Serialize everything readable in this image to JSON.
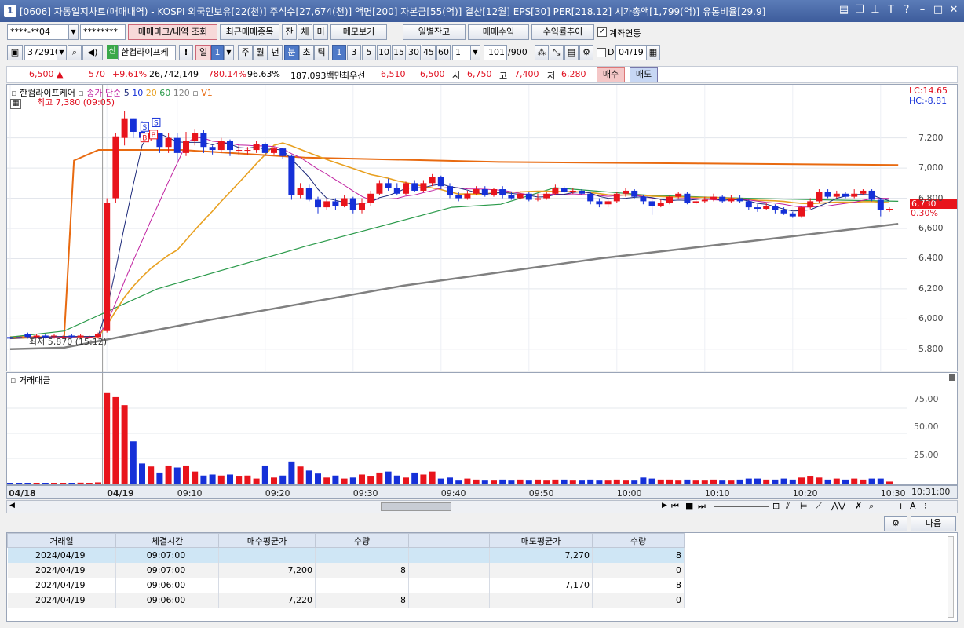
{
  "window": {
    "title": "[0606] 자동일지차트(매매내역) - KOSPI 외국인보유[22(천)] 주식수[27,674(천)] 액면[200] 자본금[55(억)] 결산[12월] EPS[30] PER[218.12] 시가총액[1,799(억)] 유통비율[29.9]",
    "icon": "1"
  },
  "toolbar1": {
    "account": "****-**04",
    "password": "********",
    "btn_mark": "매매마크/내역 조회",
    "btn_recent": "최근매매종목",
    "btn_jan": "잔",
    "btn_che": "체",
    "btn_mi": "미",
    "btn_memo": "메모보기",
    "btn_daily": "일별잔고",
    "btn_profit": "매매수익",
    "btn_trend": "수익률추이",
    "link_label": "계좌연동",
    "link_checked": true
  },
  "toolbar2": {
    "code": "372910",
    "badge": "신",
    "name": "한컴라이프케",
    "btn_excl": "!",
    "period_day": "일",
    "period_num": "1",
    "btn_week": "주",
    "btn_month": "월",
    "btn_year": "년",
    "btn_min": "분",
    "btn_sec": "초",
    "btn_tick": "틱",
    "intervals": [
      "1",
      "3",
      "5",
      "10",
      "15",
      "30",
      "45",
      "60"
    ],
    "count": "1",
    "bars": "101",
    "bars_total": "/900",
    "date_check_label": "D",
    "date": "04/19"
  },
  "quote": {
    "price": "6,500 ▲",
    "change": "570",
    "pct": "+9.61%",
    "volume": "26,742,149",
    "vol_pct": "780.14%",
    "strength": "96.63%",
    "amount": "187,093백만",
    "best_label": "최우선",
    "ask": "6,510",
    "bid": "6,500",
    "open_label": "시",
    "open": "6,750",
    "high_label": "고",
    "high": "7,400",
    "low_label": "저",
    "low": "6,280",
    "buy_btn": "매수",
    "sell_btn": "매도"
  },
  "price_chart": {
    "stock_label": "한컴라이프케어",
    "ma_label": "종가 단순",
    "ma_periods": [
      "5",
      "10",
      "20",
      "60",
      "120"
    ],
    "vi_label": "V1",
    "high_marker": "최고 7,380 (09:05)",
    "low_marker": "최저 5,870 (15:12)",
    "lc": "LC:14.65",
    "hc": "HC:-8.81",
    "current_price": "6,730",
    "current_pct": "0.30%",
    "colors": {
      "up": "#e8141c",
      "down": "#1530d8",
      "ma5": "#1d2a7a",
      "ma10": "#c020a0",
      "ma20": "#e8a020",
      "ma60": "#2a9a4a",
      "ma120": "#808080",
      "vi": "#e86a10"
    }
  },
  "volume_chart": {
    "title": "거래대금",
    "ticks": [
      "75,00",
      "50,00",
      "25,00"
    ]
  },
  "chart_data": {
    "type": "candlestick",
    "ylim": [
      5700,
      7500
    ],
    "y_ticks": [
      "7,200",
      "7,000",
      "6,800",
      "6,600",
      "6,400",
      "6,200",
      "6,000",
      "5,800"
    ],
    "x_labels": [
      "04/18",
      "04/19",
      "09:10",
      "09:20",
      "09:30",
      "09:40",
      "09:50",
      "10:00",
      "10:10",
      "10:20",
      "10:30"
    ],
    "candles": [
      [
        5880,
        5870,
        5880,
        5870,
        0.4
      ],
      [
        5880,
        5875,
        5880,
        5870,
        0.4
      ],
      [
        5900,
        5880,
        5910,
        5870,
        0.5
      ],
      [
        5880,
        5890,
        5900,
        5870,
        0.4
      ],
      [
        5890,
        5880,
        5900,
        5870,
        0.5
      ],
      [
        5885,
        5890,
        5900,
        5870,
        0.6
      ],
      [
        5880,
        5880,
        5890,
        5870,
        0.4
      ],
      [
        5890,
        5880,
        5900,
        5870,
        0.5
      ],
      [
        5880,
        5890,
        5900,
        5870,
        0.9
      ],
      [
        5880,
        5880,
        5890,
        5870,
        0.5
      ],
      [
        5880,
        5900,
        5910,
        5870,
        1.2
      ],
      [
        5920,
        6770,
        6800,
        5910,
        90
      ],
      [
        6800,
        7210,
        7230,
        6770,
        86
      ],
      [
        7200,
        7330,
        7380,
        7150,
        78
      ],
      [
        7330,
        7240,
        7330,
        7200,
        42
      ],
      [
        7240,
        7200,
        7310,
        7180,
        20
      ],
      [
        7200,
        7230,
        7240,
        7180,
        17
      ],
      [
        7230,
        7140,
        7230,
        7100,
        11
      ],
      [
        7140,
        7200,
        7230,
        7100,
        18
      ],
      [
        7200,
        7100,
        7230,
        7050,
        16
      ],
      [
        7100,
        7180,
        7240,
        7080,
        18
      ],
      [
        7180,
        7230,
        7260,
        7150,
        12
      ],
      [
        7230,
        7140,
        7250,
        7100,
        8
      ],
      [
        7140,
        7120,
        7150,
        7090,
        9
      ],
      [
        7120,
        7180,
        7200,
        7100,
        8
      ],
      [
        7180,
        7120,
        7190,
        7080,
        9
      ],
      [
        7120,
        7120,
        7150,
        7090,
        7
      ],
      [
        7120,
        7120,
        7140,
        7090,
        8
      ],
      [
        7120,
        7160,
        7180,
        7100,
        5
      ],
      [
        7160,
        7100,
        7170,
        7080,
        18
      ],
      [
        7100,
        7130,
        7140,
        7090,
        6
      ],
      [
        7130,
        7080,
        7130,
        7060,
        8
      ],
      [
        7080,
        6820,
        7090,
        6790,
        22
      ],
      [
        6820,
        6870,
        6900,
        6800,
        17
      ],
      [
        6870,
        6790,
        6890,
        6780,
        13
      ],
      [
        6790,
        6740,
        6810,
        6700,
        10
      ],
      [
        6740,
        6780,
        6800,
        6720,
        6
      ],
      [
        6780,
        6750,
        6800,
        6720,
        8
      ],
      [
        6750,
        6800,
        6820,
        6740,
        5
      ],
      [
        6800,
        6720,
        6810,
        6700,
        6
      ],
      [
        6720,
        6770,
        6800,
        6700,
        9
      ],
      [
        6770,
        6830,
        6850,
        6750,
        7
      ],
      [
        6830,
        6900,
        6920,
        6820,
        11
      ],
      [
        6900,
        6870,
        6930,
        6850,
        12
      ],
      [
        6870,
        6830,
        6900,
        6820,
        8
      ],
      [
        6830,
        6900,
        6910,
        6820,
        6
      ],
      [
        6900,
        6850,
        6920,
        6840,
        11
      ],
      [
        6850,
        6900,
        6920,
        6840,
        9
      ],
      [
        6900,
        6940,
        6960,
        6880,
        12
      ],
      [
        6940,
        6880,
        6950,
        6860,
        5
      ],
      [
        6880,
        6820,
        6900,
        6800,
        6
      ],
      [
        6820,
        6800,
        6840,
        6780,
        3
      ],
      [
        6800,
        6830,
        6850,
        6790,
        5
      ],
      [
        6830,
        6860,
        6880,
        6820,
        4
      ],
      [
        6860,
        6820,
        6880,
        6810,
        3
      ],
      [
        6820,
        6860,
        6870,
        6810,
        3
      ],
      [
        6860,
        6820,
        6880,
        6800,
        4
      ],
      [
        6820,
        6800,
        6840,
        6790,
        3
      ],
      [
        6800,
        6830,
        6850,
        6790,
        4
      ],
      [
        6830,
        6790,
        6840,
        6780,
        3
      ],
      [
        6790,
        6800,
        6830,
        6780,
        4
      ],
      [
        6800,
        6830,
        6840,
        6790,
        3
      ],
      [
        6830,
        6870,
        6890,
        6820,
        4
      ],
      [
        6870,
        6840,
        6880,
        6830,
        4
      ],
      [
        6840,
        6850,
        6870,
        6830,
        3
      ],
      [
        6850,
        6830,
        6860,
        6820,
        3
      ],
      [
        6830,
        6780,
        6840,
        6760,
        4
      ],
      [
        6780,
        6760,
        6800,
        6740,
        3
      ],
      [
        6760,
        6780,
        6800,
        6740,
        3
      ],
      [
        6780,
        6830,
        6840,
        6770,
        4
      ],
      [
        6830,
        6850,
        6870,
        6810,
        3
      ],
      [
        6850,
        6810,
        6860,
        6800,
        3
      ],
      [
        6810,
        6780,
        6820,
        6760,
        6
      ],
      [
        6780,
        6750,
        6790,
        6690,
        5
      ],
      [
        6750,
        6770,
        6790,
        6740,
        4
      ],
      [
        6770,
        6810,
        6820,
        6760,
        4
      ],
      [
        6810,
        6830,
        6840,
        6800,
        3
      ],
      [
        6830,
        6770,
        6840,
        6760,
        4
      ],
      [
        6770,
        6780,
        6800,
        6760,
        3
      ],
      [
        6780,
        6790,
        6810,
        6770,
        3
      ],
      [
        6790,
        6810,
        6830,
        6780,
        4
      ],
      [
        6810,
        6780,
        6820,
        6770,
        3
      ],
      [
        6780,
        6800,
        6820,
        6770,
        3
      ],
      [
        6800,
        6780,
        6820,
        6770,
        4
      ],
      [
        6780,
        6740,
        6790,
        6720,
        5
      ],
      [
        6740,
        6730,
        6760,
        6710,
        5
      ],
      [
        6730,
        6750,
        6770,
        6720,
        4
      ],
      [
        6750,
        6720,
        6760,
        6700,
        4
      ],
      [
        6720,
        6700,
        6740,
        6690,
        5
      ],
      [
        6700,
        6680,
        6710,
        6670,
        4
      ],
      [
        6680,
        6740,
        6750,
        6670,
        6
      ],
      [
        6740,
        6780,
        6800,
        6730,
        7
      ],
      [
        6780,
        6840,
        6860,
        6770,
        6
      ],
      [
        6840,
        6810,
        6860,
        6800,
        4
      ],
      [
        6810,
        6830,
        6850,
        6800,
        5
      ],
      [
        6830,
        6810,
        6840,
        6800,
        4
      ],
      [
        6810,
        6830,
        6860,
        6800,
        5
      ],
      [
        6830,
        6850,
        6860,
        6820,
        4
      ],
      [
        6850,
        6790,
        6860,
        6780,
        5
      ],
      [
        6790,
        6720,
        6800,
        6680,
        5
      ],
      [
        6720,
        6730,
        6740,
        6710,
        2
      ]
    ],
    "ma_trend": {
      "ma60": [
        [
          0,
          5880
        ],
        [
          11,
          5920
        ],
        [
          30,
          6200
        ],
        [
          60,
          6480
        ],
        [
          90,
          6740
        ],
        [
          100,
          6760
        ],
        [
          111,
          6870
        ],
        [
          130,
          6820
        ],
        [
          150,
          6800
        ],
        [
          165,
          6790
        ],
        [
          181,
          6780
        ]
      ],
      "ma120": [
        [
          0,
          5800
        ],
        [
          11,
          5810
        ],
        [
          40,
          5990
        ],
        [
          80,
          6220
        ],
        [
          120,
          6400
        ],
        [
          160,
          6550
        ],
        [
          181,
          6630
        ]
      ],
      "vi": [
        [
          0,
          5880
        ],
        [
          11,
          5880
        ],
        [
          13,
          7050
        ],
        [
          18,
          7120
        ],
        [
          35,
          7120
        ],
        [
          60,
          7070
        ],
        [
          100,
          7040
        ],
        [
          140,
          7030
        ],
        [
          181,
          7020
        ]
      ]
    }
  },
  "trades_table": {
    "headers": [
      "거래일",
      "체결시간",
      "매수평균가",
      "수량",
      "",
      "매도평균가",
      "수량"
    ],
    "rows": [
      [
        "2024/04/19",
        "09:07:00",
        "",
        "",
        "",
        "7,270",
        "8"
      ],
      [
        "2024/04/19",
        "09:07:00",
        "7,200",
        "8",
        "",
        "",
        "0"
      ],
      [
        "2024/04/19",
        "09:06:00",
        "",
        "",
        "",
        "7,170",
        "8"
      ],
      [
        "2024/04/19",
        "09:06:00",
        "7,220",
        "8",
        "",
        "",
        "0"
      ]
    ],
    "next_btn": "다음"
  }
}
